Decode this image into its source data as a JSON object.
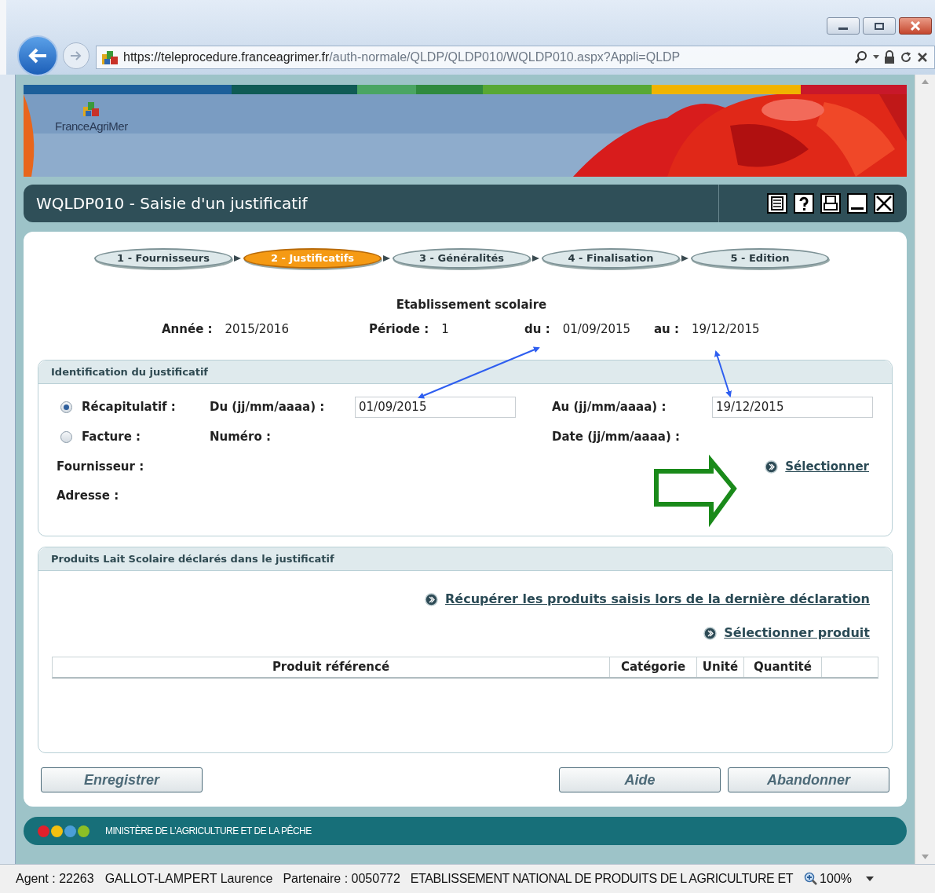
{
  "browser": {
    "url_host": "https://teleprocedure.franceagrimer.fr",
    "url_path": "/auth-normale/QLDP/QLDP010/WQLDP010.aspx?Appli=QLDP"
  },
  "banner": {
    "logo_text": "FranceAgriMer"
  },
  "page_title": "WQLDP010 - Saisie d'un justificatif",
  "steps": [
    {
      "label": "1 - Fournisseurs",
      "selected": false
    },
    {
      "label": "2 - Justificatifs",
      "selected": true
    },
    {
      "label": "3 - Généralités",
      "selected": false
    },
    {
      "label": "4 - Finalisation",
      "selected": false
    },
    {
      "label": "5 - Edition",
      "selected": false
    }
  ],
  "summary": {
    "title": "Etablissement scolaire",
    "fields": [
      {
        "label": "Année :",
        "value": "2015/2016"
      },
      {
        "label": "Période :",
        "value": "1"
      },
      {
        "label": "du :",
        "value": "01/09/2015"
      },
      {
        "label": "au :",
        "value": "19/12/2015"
      }
    ]
  },
  "identification": {
    "title": "Identification du justificatif",
    "options": [
      {
        "label": "Récapitulatif :",
        "selected": true
      },
      {
        "label": "Facture :",
        "selected": false
      }
    ],
    "du_label": "Du (jj/mm/aaaa) :",
    "du_value": "01/09/2015",
    "au_label": "Au (jj/mm/aaaa) :",
    "au_value": "19/12/2015",
    "numero_label": "Numéro :",
    "date_label": "Date (jj/mm/aaaa) :",
    "fournisseur_label": "Fournisseur :",
    "adresse_label": "Adresse :",
    "select_link": "Sélectionner"
  },
  "produits": {
    "title": "Produits Lait Scolaire déclarés dans le justificatif",
    "links": [
      "Récupérer les produits saisis lors de la dernière déclaration",
      "Sélectionner produit"
    ],
    "columns": [
      "Produit référencé",
      "Catégorie",
      "Unité",
      "Quantité"
    ]
  },
  "buttons": [
    "Enregistrer",
    "Aide",
    "Abandonner"
  ],
  "footer": {
    "text": "MINISTÈRE DE L'AGRICULTURE ET DE LA PÊCHE",
    "dots": [
      {
        "color": "#e0202c"
      },
      {
        "color": "#f2c010"
      },
      {
        "color": "#4a9ed8"
      },
      {
        "color": "#8cbf26"
      }
    ]
  },
  "status_bar": {
    "agent": "Agent : 22263",
    "name": "GALLOT-LAMPERT Laurence",
    "partenaire": "Partenaire : 0050772",
    "organisation": "ETABLISSEMENT NATIONAL DE PRODUITS DE L AGRICULTURE ET",
    "zoom": "100%"
  }
}
